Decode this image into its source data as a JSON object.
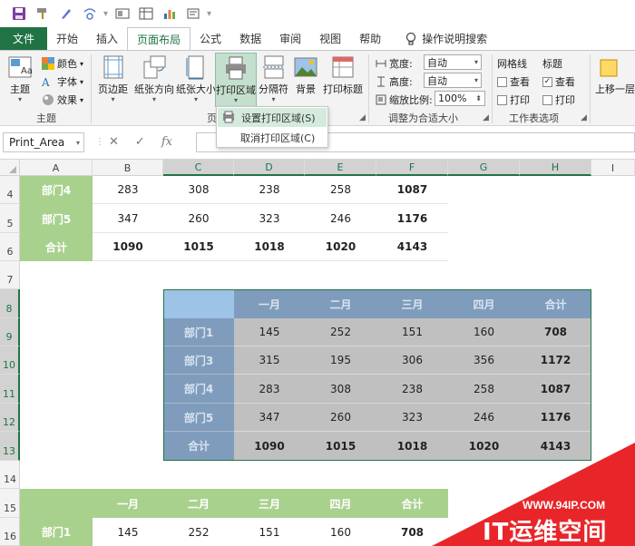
{
  "tabs": [
    "文件",
    "开始",
    "插入",
    "页面布局",
    "公式",
    "数据",
    "审阅",
    "视图",
    "帮助"
  ],
  "search_label": "操作说明搜索",
  "ribbon": {
    "theme": {
      "label": "主题",
      "colors": "颜色",
      "fonts": "字体",
      "effects": "效果",
      "group": "主题"
    },
    "margins": "页边距",
    "orientation": "纸张方向",
    "size": "纸张大小",
    "print_area": "打印区域",
    "breaks": "分隔符",
    "background": "背景",
    "print_titles": "打印标题",
    "page_setup_group": "页",
    "scale": {
      "width_label": "宽度:",
      "width_value": "自动",
      "height_label": "高度:",
      "height_value": "自动",
      "scale_label": "缩放比例:",
      "scale_value": "100%",
      "group": "调整为合适大小"
    },
    "sheet_options": {
      "gridlines": "网格线",
      "headings": "标题",
      "view": "查看",
      "print": "打印",
      "group": "工作表选项"
    },
    "bring_forward": "上移一层"
  },
  "menu": {
    "set_area": "设置打印区域(S)",
    "clear_area": "取消打印区域(C)"
  },
  "name_box": "Print_Area",
  "columns": [
    "A",
    "B",
    "C",
    "D",
    "E",
    "F",
    "G",
    "H",
    "I"
  ],
  "rows": [
    "4",
    "5",
    "6",
    "7",
    "8",
    "9",
    "10",
    "11",
    "12",
    "13",
    "14",
    "15",
    "16"
  ],
  "top_table": [
    {
      "label": "部门4",
      "values": [
        "283",
        "308",
        "238",
        "258",
        "1087"
      ]
    },
    {
      "label": "部门5",
      "values": [
        "347",
        "260",
        "323",
        "246",
        "1176"
      ]
    },
    {
      "label": "合计",
      "values": [
        "1090",
        "1015",
        "1018",
        "1020",
        "4143"
      ]
    }
  ],
  "months": [
    "一月",
    "二月",
    "三月",
    "四月",
    "合计"
  ],
  "mid_table": [
    {
      "label": "部门1",
      "values": [
        "145",
        "252",
        "151",
        "160",
        "708"
      ]
    },
    {
      "label": "部门3",
      "values": [
        "315",
        "195",
        "306",
        "356",
        "1172"
      ]
    },
    {
      "label": "部门4",
      "values": [
        "283",
        "308",
        "238",
        "258",
        "1087"
      ]
    },
    {
      "label": "部门5",
      "values": [
        "347",
        "260",
        "323",
        "246",
        "1176"
      ]
    },
    {
      "label": "合计",
      "values": [
        "1090",
        "1015",
        "1018",
        "1020",
        "4143"
      ]
    }
  ],
  "bottom_table": [
    {
      "label": "部门1",
      "values": [
        "145",
        "252",
        "151",
        "160",
        "708"
      ]
    }
  ],
  "watermark": {
    "url": "WWW.94IP.COM",
    "brand": "IT运维空间"
  },
  "colors": {
    "excel_green": "#217346",
    "table_green": "#a9d18e",
    "table_blue": "#7f9cbc",
    "table_light_blue": "#9dc3e6",
    "table_gray": "#c0c0c0",
    "watermark_red": "#e8262a"
  }
}
